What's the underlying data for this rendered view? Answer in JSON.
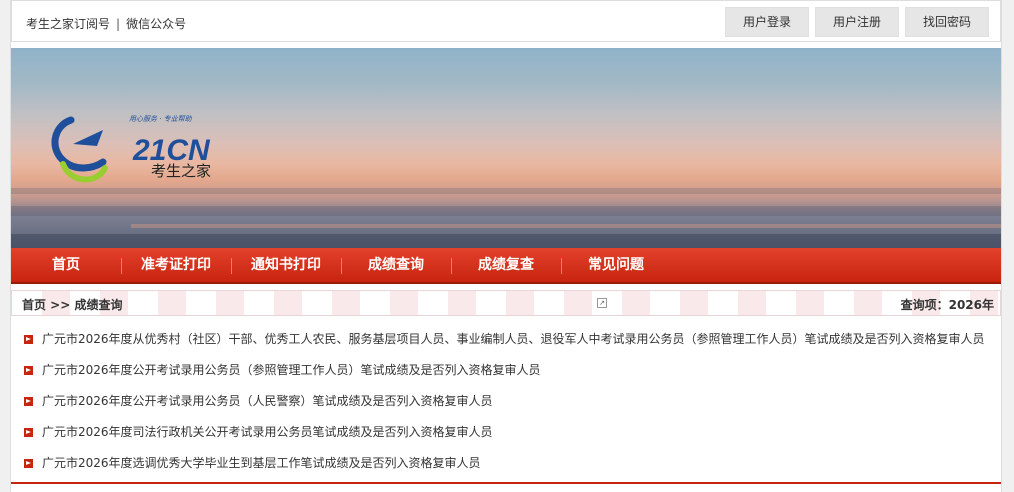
{
  "topbar": {
    "link1": "考生之家订阅号",
    "separator": "|",
    "link2": "微信公众号",
    "login": "用户登录",
    "register": "用户注册",
    "recover": "找回密码"
  },
  "logo": {
    "mark": "21CN",
    "tagline": "用心服务 · 专业帮助",
    "name": "考生之家"
  },
  "nav": [
    "首页",
    "准考证打印",
    "通知书打印",
    "成绩查询",
    "成绩复查",
    "常见问题"
  ],
  "breadcrumb": {
    "path": "首页 >> 成绩查询",
    "query": "查询项：2026年"
  },
  "items": [
    "广元市2026年度从优秀村（社区）干部、优秀工人农民、服务基层项目人员、事业编制人员、退役军人中考试录用公务员（参照管理工作人员）笔试成绩及是否列入资格复审人员",
    "广元市2026年度公开考试录用公务员（参照管理工作人员）笔试成绩及是否列入资格复审人员",
    "广元市2026年度公开考试录用公务员（人民警察）笔试成绩及是否列入资格复审人员",
    "广元市2026年度司法行政机关公开考试录用公务员笔试成绩及是否列入资格复审人员",
    "广元市2026年度选调优秀大学毕业生到基层工作笔试成绩及是否列入资格复审人员"
  ],
  "colors": {
    "accent": "#c8240f",
    "logo_blue": "#1f4f9a",
    "logo_green": "#9acd32"
  }
}
